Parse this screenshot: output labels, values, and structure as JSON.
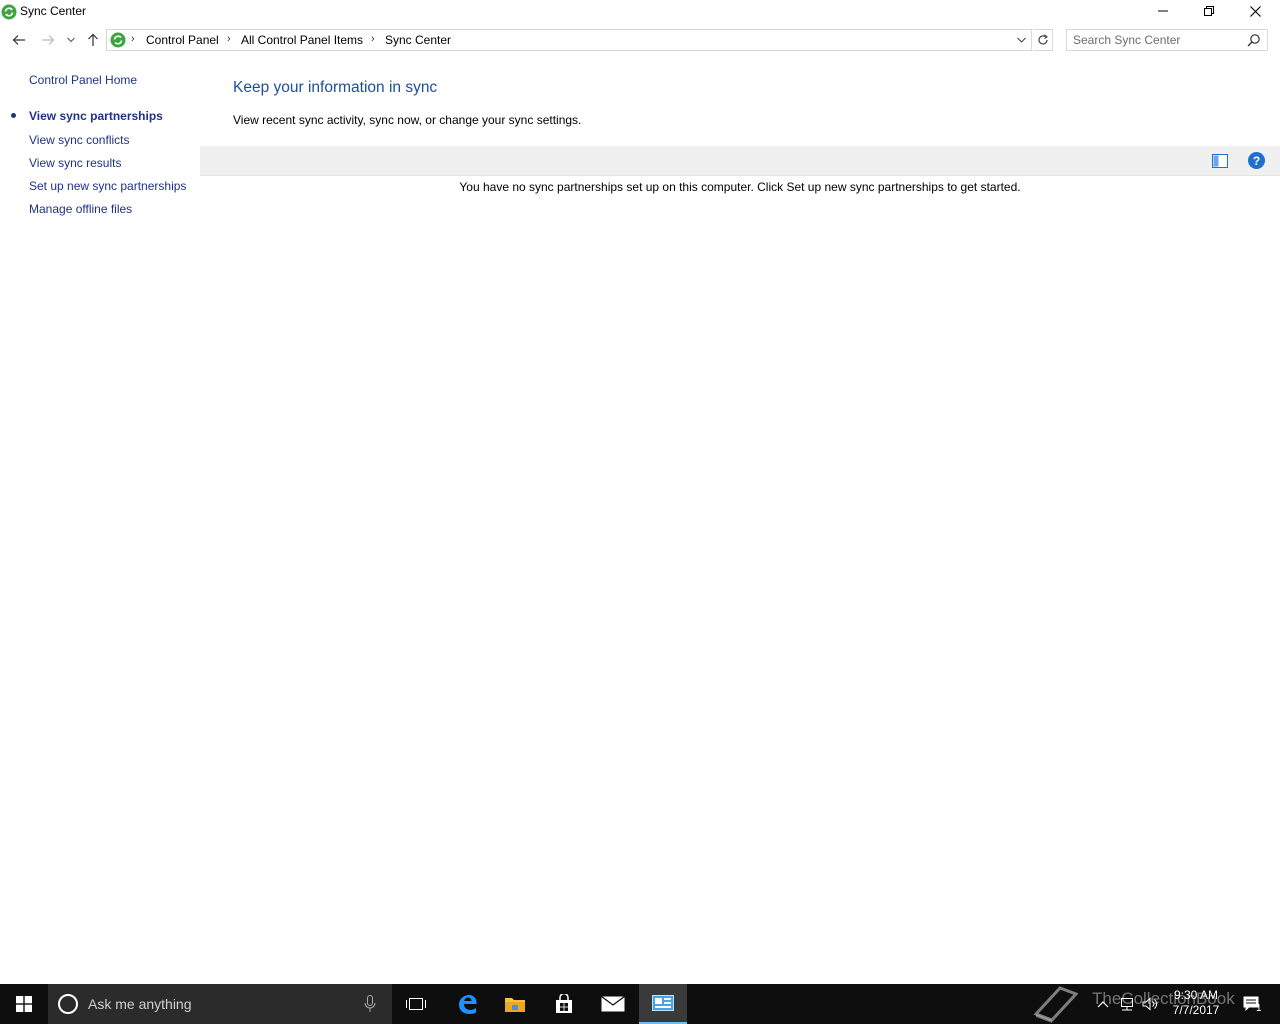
{
  "window": {
    "title": "Sync Center",
    "controls": {
      "minimize": "minimize",
      "maximize": "restore",
      "close": "close"
    }
  },
  "navigation": {
    "breadcrumbs": [
      "Control Panel",
      "All Control Panel Items",
      "Sync Center"
    ],
    "search_placeholder": "Search Sync Center"
  },
  "left_pane": {
    "home_link": "Control Panel Home",
    "links": [
      {
        "label": "View sync partnerships",
        "active": true
      },
      {
        "label": "View sync conflicts",
        "active": false
      },
      {
        "label": "View sync results",
        "active": false
      },
      {
        "label": "Set up new sync partnerships",
        "active": false
      },
      {
        "label": "Manage offline files",
        "active": false
      }
    ]
  },
  "main": {
    "heading": "Keep your information in sync",
    "subtext": "View recent sync activity, sync now, or change your sync settings.",
    "empty_message": "You have no sync partnerships set up on this computer. Click Set up new sync partnerships to get started.",
    "toolbar": {
      "help_label": "?"
    }
  },
  "taskbar": {
    "search_text": "Ask me anything",
    "watermark_text": "TheCollectionBook",
    "clock": {
      "time": "9:30 AM",
      "date": "7/7/2017"
    },
    "notification_count": "1",
    "colors": {
      "background": "#0e0e0e",
      "search_box": "#2b2b2b",
      "active_underline": "#76b9ed"
    }
  },
  "colors": {
    "link": "#1e3287",
    "heading": "#1e4e9a",
    "toolbar": "#f0f0f0",
    "help": "#1f6fd1"
  }
}
